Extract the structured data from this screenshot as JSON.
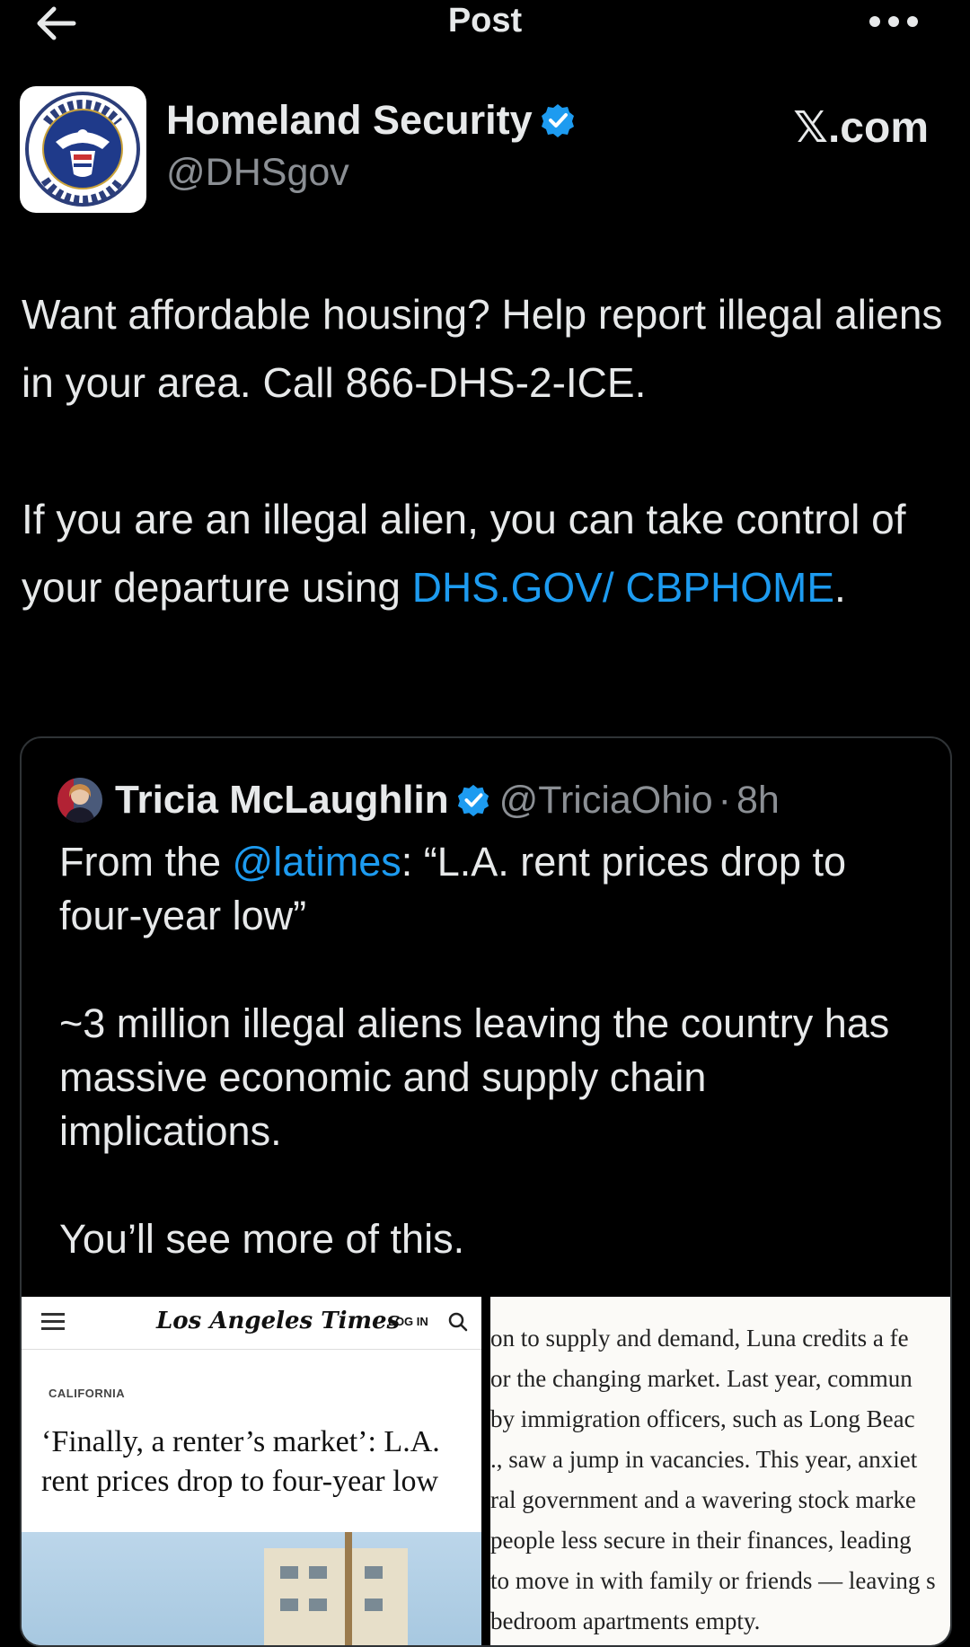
{
  "topbar": {
    "title": "Post"
  },
  "author": {
    "name": "Homeland Security",
    "handle": "@DHSgov",
    "brand": "𝕏.com",
    "seal_text": "U.S. DEPARTMENT OF HOMELAND SECURITY"
  },
  "tweet": {
    "p1": "Want affordable housing? Help report illegal aliens in your area. Call 866-DHS-2-ICE.",
    "p2_prefix": "If you are an illegal alien, you can take control of your departure using ",
    "p2_link": "DHS.GOV/ CBPHOME",
    "p2_suffix": "."
  },
  "quote": {
    "name": "Tricia McLaughlin",
    "handle": "@TriciaOhio",
    "dot": "·",
    "time": "8h",
    "line1_prefix": "From the ",
    "line1_mention": "@latimes",
    "line1_suffix": ": “L.A. rent prices drop to four-year low”",
    "p2": "~3 million illegal aliens leaving the country has massive economic and supply chain implications.",
    "p3": "You’ll see more of this."
  },
  "images": {
    "left": {
      "logo": "Los Angeles Times",
      "login": "LOG IN",
      "section": "CALIFORNIA",
      "headline": "‘Finally, a renter’s market’: L.A. rent prices drop to four-year low"
    },
    "right": {
      "lines": [
        "on to supply and demand, Luna credits a fe",
        "or the changing market. Last year, commun",
        "by immigration officers, such as Long Beac",
        "., saw a jump in vacancies. This year, anxiet",
        "ral government and a wavering stock marke",
        "people less secure in their finances, leading",
        "to move in with family or friends — leaving s",
        "bedroom apartments empty."
      ]
    }
  },
  "colors": {
    "background": "#000000",
    "link": "#1d9bf0",
    "verified": "#1d9bf0",
    "text": "#e7e9ea",
    "muted": "#8b8f94"
  },
  "icons": {
    "back": "arrow-left-icon",
    "more": "more-horizontal-icon",
    "verified": "verified-badge-icon"
  }
}
